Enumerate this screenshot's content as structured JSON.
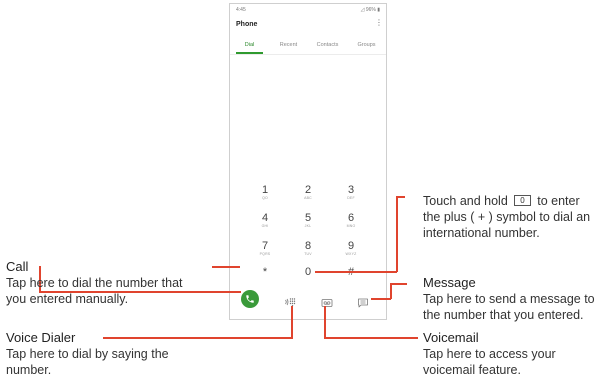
{
  "phone": {
    "status_time": "4:45",
    "status_right": "◿ 96% ▮",
    "app_title": "Phone",
    "tabs": [
      {
        "label": "Dial",
        "active": true
      },
      {
        "label": "Recent",
        "active": false
      },
      {
        "label": "Contacts",
        "active": false
      },
      {
        "label": "Groups",
        "active": false
      }
    ],
    "keys": [
      {
        "digit": "1",
        "letters": "QO"
      },
      {
        "digit": "2",
        "letters": "ABC"
      },
      {
        "digit": "3",
        "letters": "DEF"
      },
      {
        "digit": "4",
        "letters": "GHI"
      },
      {
        "digit": "5",
        "letters": "JKL"
      },
      {
        "digit": "6",
        "letters": "MNO"
      },
      {
        "digit": "7",
        "letters": "PQRS"
      },
      {
        "digit": "8",
        "letters": "TUV"
      },
      {
        "digit": "9",
        "letters": "WXYZ"
      },
      {
        "digit": "*",
        "letters": ""
      },
      {
        "digit": "0",
        "letters": ""
      },
      {
        "digit": "#",
        "letters": ""
      }
    ],
    "icons": {
      "call": "phone-icon",
      "voice_dialer": "voice-dialer-icon",
      "voicemail": "voicemail-icon",
      "message": "message-icon"
    },
    "accent_color": "#3a9a3a",
    "callout_color": "#e0442e"
  },
  "annotations": {
    "zero_key": {
      "line1_a": "Touch and hold",
      "key_glyph": "0",
      "line1_b": "to enter",
      "line2": "the plus ( + ) symbol to dial an",
      "line3": "international number."
    },
    "call": {
      "title": "Call",
      "line1": "Tap here to dial the number that",
      "line2": "you entered manually."
    },
    "message": {
      "title": "Message",
      "line1": "Tap here to send a message to",
      "line2": "the number that you entered."
    },
    "voice_dialer": {
      "title": "Voice Dialer",
      "line1": "Tap here to dial by saying the",
      "line2": "number."
    },
    "voicemail": {
      "title": "Voicemail",
      "line1": "Tap here to access your",
      "line2": "voicemail feature."
    }
  }
}
